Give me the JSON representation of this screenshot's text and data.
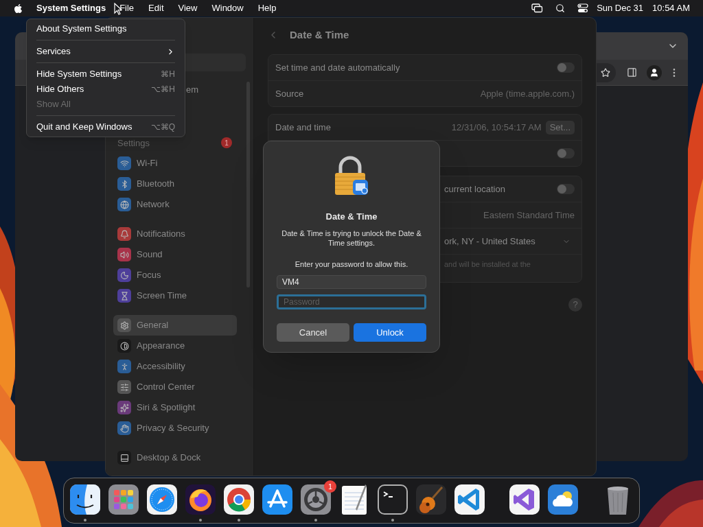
{
  "menu_bar": {
    "app_name": "System Settings",
    "menus": [
      "File",
      "Edit",
      "View",
      "Window",
      "Help"
    ],
    "date": "Sun Dec 31",
    "time": "10:54 AM"
  },
  "app_menu": {
    "items": [
      {
        "kind": "item",
        "label": "About System Settings",
        "disabled": false
      },
      {
        "kind": "separator"
      },
      {
        "kind": "submenu",
        "label": "Services",
        "disabled": false
      },
      {
        "kind": "separator"
      },
      {
        "kind": "item",
        "label": "Hide System Settings",
        "shortcut": "⌘H",
        "disabled": false
      },
      {
        "kind": "item",
        "label": "Hide Others",
        "shortcut": "⌥⌘H",
        "disabled": false
      },
      {
        "kind": "item",
        "label": "Show All",
        "disabled": true
      },
      {
        "kind": "separator"
      },
      {
        "kind": "item",
        "label": "Quit and Keep Windows",
        "shortcut": "⌥⌘Q",
        "disabled": false
      }
    ]
  },
  "settings_window": {
    "sidebar": {
      "account_fragment": "em",
      "account_label": "Settings",
      "badge": "1",
      "groups": [
        [
          {
            "label": "Wi-Fi",
            "color": "#2a5d96",
            "selected": false
          },
          {
            "label": "Bluetooth",
            "color": "#2a5d96",
            "selected": false
          },
          {
            "label": "Network",
            "color": "#2a5d96",
            "selected": false
          }
        ],
        [
          {
            "label": "Notifications",
            "color": "#a83a3a",
            "selected": false
          },
          {
            "label": "Sound",
            "color": "#a8334a",
            "selected": false
          },
          {
            "label": "Focus",
            "color": "#4e3f9a",
            "selected": false
          },
          {
            "label": "Screen Time",
            "color": "#4e3f9a",
            "selected": false
          }
        ],
        [
          {
            "label": "General",
            "color": "#555555",
            "selected": true
          },
          {
            "label": "Appearance",
            "color": "#1a1a1a",
            "selected": false
          },
          {
            "label": "Accessibility",
            "color": "#2a5d96",
            "selected": false
          },
          {
            "label": "Control Center",
            "color": "#555555",
            "selected": false
          },
          {
            "label": "Siri & Spotlight",
            "color": "#6a3a7a",
            "selected": false
          },
          {
            "label": "Privacy & Security",
            "color": "#2a5d96",
            "selected": false
          }
        ],
        [
          {
            "label": "Desktop & Dock",
            "color": "#1a1a1a",
            "selected": false
          }
        ]
      ]
    },
    "content": {
      "title": "Date & Time",
      "help": "?",
      "groups": [
        {
          "rows": [
            {
              "kind": "toggle",
              "label": "Set time and date automatically",
              "on": false
            },
            {
              "kind": "value",
              "label": "Source",
              "value": "Apple (time.apple.com.)"
            }
          ]
        },
        {
          "rows": [
            {
              "kind": "value_button",
              "label": "Date and time",
              "value": "12/31/06, 10:54:17 AM",
              "button": "Set..."
            },
            {
              "kind": "toggle",
              "on": false
            }
          ]
        },
        {
          "rows": [
            {
              "kind": "toggle",
              "partial_label": "current location",
              "on": false
            },
            {
              "kind": "value",
              "value": "Eastern Standard Time"
            },
            {
              "kind": "select",
              "value": "ork, NY - United States"
            },
            {
              "kind": "note",
              "value": "and will be installed at the"
            }
          ]
        }
      ]
    }
  },
  "dialog": {
    "title": "Date & Time",
    "message": "Date & Time is trying to unlock the Date & Time settings.",
    "prompt": "Enter your password to allow this.",
    "username": "VM4",
    "password_placeholder": "Password",
    "password_focused": true,
    "buttons": [
      {
        "kind": "secondary",
        "label": "Cancel"
      },
      {
        "kind": "primary",
        "label": "Unlock"
      }
    ]
  },
  "dock": {
    "items": [
      {
        "kind": "finder",
        "running": true
      },
      {
        "kind": "launchpad",
        "running": false
      },
      {
        "kind": "safari",
        "running": false
      },
      {
        "kind": "firefox",
        "running": true
      },
      {
        "kind": "chrome",
        "running": true
      },
      {
        "kind": "appstore",
        "running": false
      },
      {
        "kind": "settings",
        "running": true,
        "badge": "1"
      },
      {
        "kind": "textedit",
        "running": false
      },
      {
        "kind": "terminal",
        "running": true
      },
      {
        "kind": "garageband",
        "running": false
      },
      {
        "kind": "vscode",
        "running": false
      },
      {
        "kind": "separator"
      },
      {
        "kind": "visualstudio",
        "running": false
      },
      {
        "kind": "weather",
        "running": false
      },
      {
        "kind": "separator"
      },
      {
        "kind": "trash",
        "running": false
      }
    ]
  }
}
